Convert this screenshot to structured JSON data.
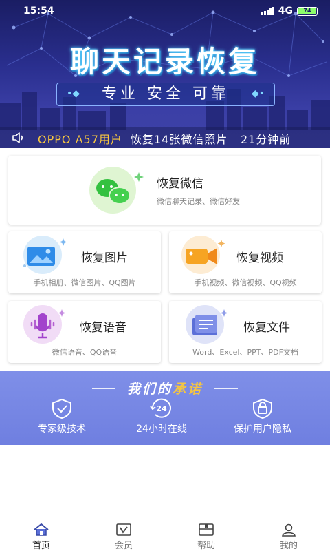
{
  "status_bar": {
    "time": "15:54",
    "network": "4G",
    "battery": "74"
  },
  "banner": {
    "title": "聊天记录恢复",
    "subtitle": "专业 安全 可靠",
    "ticker": {
      "user": "OPPO A57用户",
      "message": "恢复14张微信照片",
      "time_ago": "21分钟前"
    }
  },
  "services": [
    {
      "name": "恢复微信",
      "desc": "微信聊天记录、微信好友",
      "icon": "wechat-icon"
    },
    {
      "name": "恢复图片",
      "desc": "手机相册、微信图片、QQ图片",
      "icon": "image-icon"
    },
    {
      "name": "恢复视频",
      "desc": "手机视频、微信视频、QQ视频",
      "icon": "video-camera-icon"
    },
    {
      "name": "恢复语音",
      "desc": "微信语音、QQ语音",
      "icon": "microphone-icon"
    },
    {
      "name": "恢复文件",
      "desc": "Word、Excel、PPT、PDF文档",
      "icon": "document-icon"
    }
  ],
  "promise": {
    "title_part1": "我们的",
    "title_part2": "承诺",
    "items": [
      {
        "label": "专家级技术",
        "icon": "shield-check-icon"
      },
      {
        "label": "24小时在线",
        "icon": "clock-24-icon"
      },
      {
        "label": "保护用户隐私",
        "icon": "lock-shield-icon"
      }
    ]
  },
  "nav": [
    {
      "label": "首页",
      "icon": "home-icon",
      "active": true
    },
    {
      "label": "会员",
      "icon": "vip-icon",
      "active": false
    },
    {
      "label": "帮助",
      "icon": "book-icon",
      "active": false
    },
    {
      "label": "我的",
      "icon": "user-icon",
      "active": false
    }
  ],
  "colors": {
    "accent_gold": "#f6c640",
    "banner_bg": "#2a2f8f",
    "promise_bg": "#7f8fe8"
  }
}
